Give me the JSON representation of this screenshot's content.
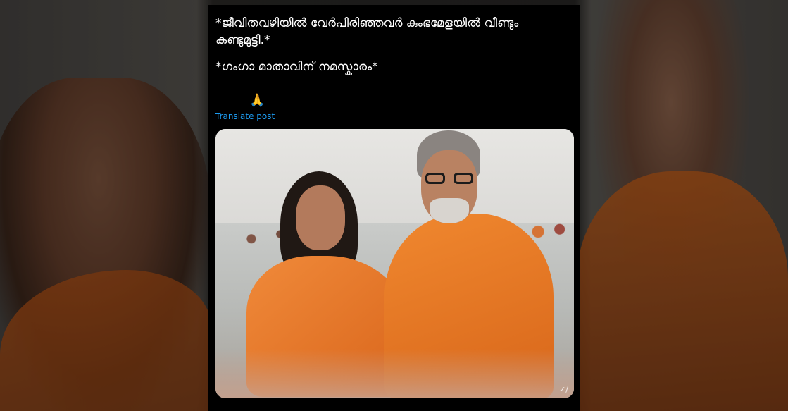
{
  "post": {
    "line1": "*ജീവിതവഴിയിൽ വേർപിരിഞ്ഞവർ കുംഭമേളയിൽ  വീണ്ടും കണ്ടുമുട്ടി.*",
    "line2": "*ഗംഗാ മാതാവിന് നമസ്കാരം*",
    "emoji": "🙏",
    "translate_label": "Translate post"
  },
  "media": {
    "watermark": "✓/"
  },
  "colors": {
    "link": "#1d9bf0",
    "post_background": "#000000",
    "robe_orange": "#e87828"
  }
}
